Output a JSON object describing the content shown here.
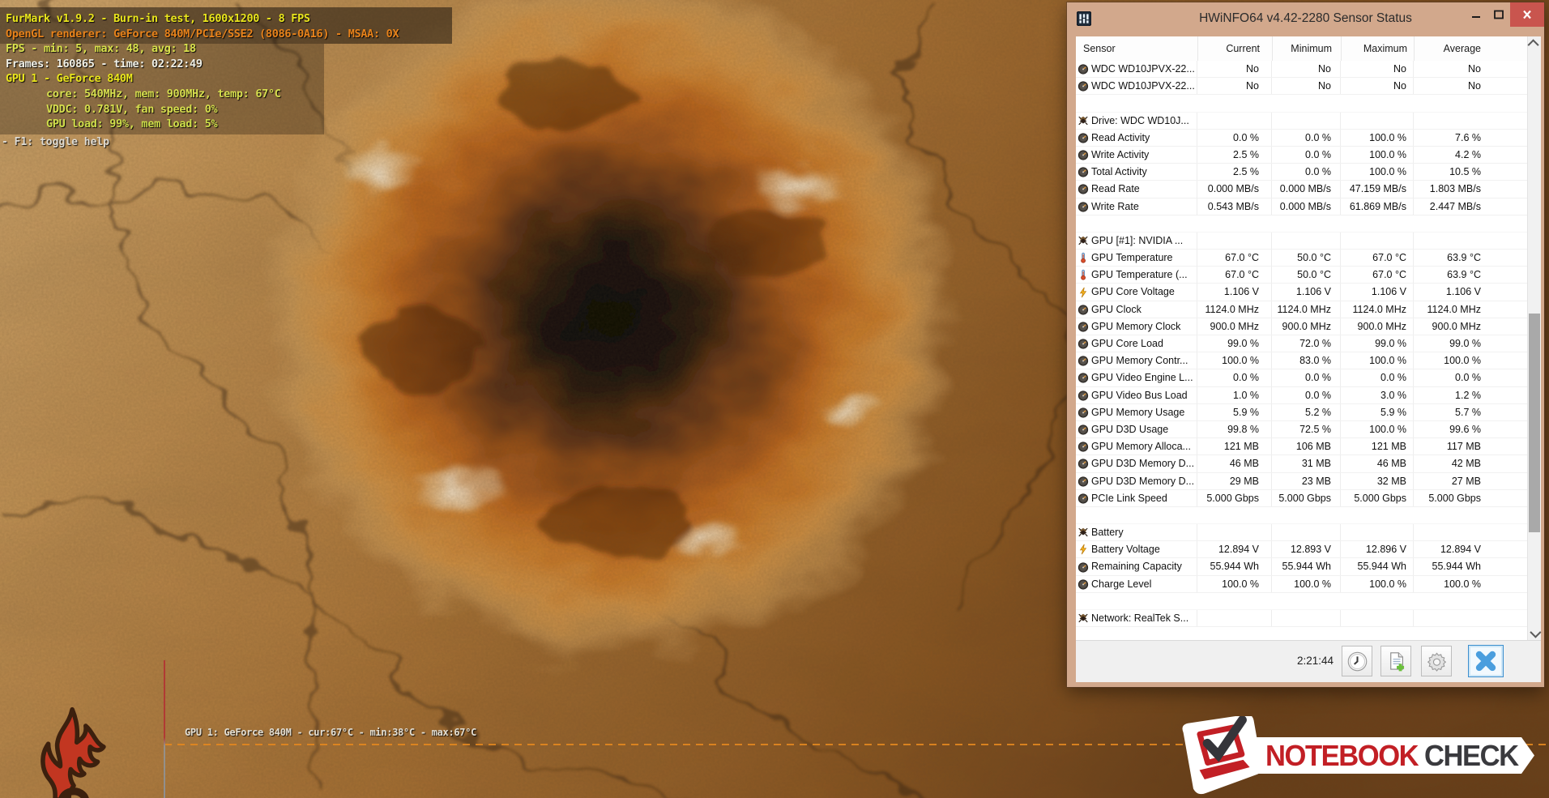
{
  "furmark_osd": {
    "lines": [
      {
        "text": "FurMark v1.9.2 - Burn-in test, 1600x1200 - 8 FPS",
        "color": "#e9e51c",
        "indent": false
      },
      {
        "text": "OpenGL renderer: GeForce 840M/PCIe/SSE2 (8086-0A16) - MSAA: 0X",
        "color": "#e8821a",
        "indent": false
      },
      {
        "text": "FPS - min: 5, max: 48, avg: 18",
        "color": "#d9e24c",
        "indent": false
      },
      {
        "text": "Frames: 160865 - time: 02:22:49",
        "color": "#efefe6",
        "indent": false
      },
      {
        "text": "GPU 1 - GeForce 840M",
        "color": "#e9e51c",
        "indent": false
      },
      {
        "text": "core: 540MHz, mem: 900MHz, temp: 67°C",
        "color": "#d6de4e",
        "indent": true
      },
      {
        "text": "VDDC: 0.781V, fan speed: 0%",
        "color": "#d6de4e",
        "indent": true
      },
      {
        "text": "GPU load: 99%, mem load: 5%",
        "color": "#cede4a",
        "indent": true
      }
    ],
    "help_text": "- F1: toggle help",
    "temp_graph_label": "GPU 1: GeForce 840M - cur:67°C - min:38°C - max:67°C"
  },
  "hwinfo": {
    "title": "HWiNFO64 v4.42-2280 Sensor Status",
    "columns": [
      "Sensor",
      "Current",
      "Minimum",
      "Maximum",
      "Average"
    ],
    "rows": [
      {
        "type": "sensor",
        "icon": "gauge-icon",
        "label": "WDC WD10JPVX-22...",
        "values": [
          "No",
          "No",
          "No",
          "No"
        ]
      },
      {
        "type": "sensor",
        "icon": "gauge-icon",
        "label": "WDC WD10JPVX-22...",
        "values": [
          "No",
          "No",
          "No",
          "No"
        ]
      },
      {
        "type": "blank"
      },
      {
        "type": "section",
        "icon": "chip-icon",
        "label": "Drive: WDC WD10J..."
      },
      {
        "type": "sensor",
        "icon": "gauge-icon",
        "label": "Read Activity",
        "values": [
          "0.0 %",
          "0.0 %",
          "100.0 %",
          "7.6 %"
        ]
      },
      {
        "type": "sensor",
        "icon": "gauge-icon",
        "label": "Write Activity",
        "values": [
          "2.5 %",
          "0.0 %",
          "100.0 %",
          "4.2 %"
        ]
      },
      {
        "type": "sensor",
        "icon": "gauge-icon",
        "label": "Total Activity",
        "values": [
          "2.5 %",
          "0.0 %",
          "100.0 %",
          "10.5 %"
        ]
      },
      {
        "type": "sensor",
        "icon": "gauge-icon",
        "label": "Read Rate",
        "values": [
          "0.000 MB/s",
          "0.000 MB/s",
          "47.159 MB/s",
          "1.803 MB/s"
        ]
      },
      {
        "type": "sensor",
        "icon": "gauge-icon",
        "label": "Write Rate",
        "values": [
          "0.543 MB/s",
          "0.000 MB/s",
          "61.869 MB/s",
          "2.447 MB/s"
        ]
      },
      {
        "type": "blank"
      },
      {
        "type": "section",
        "icon": "chip-icon",
        "label": "GPU [#1]: NVIDIA ..."
      },
      {
        "type": "sensor",
        "icon": "temp-icon",
        "label": "GPU Temperature",
        "values": [
          "67.0 °C",
          "50.0 °C",
          "67.0 °C",
          "63.9 °C"
        ]
      },
      {
        "type": "sensor",
        "icon": "temp-icon",
        "label": "GPU Temperature (...",
        "values": [
          "67.0 °C",
          "50.0 °C",
          "67.0 °C",
          "63.9 °C"
        ]
      },
      {
        "type": "sensor",
        "icon": "volt-icon",
        "label": "GPU Core Voltage",
        "values": [
          "1.106 V",
          "1.106 V",
          "1.106 V",
          "1.106 V"
        ]
      },
      {
        "type": "sensor",
        "icon": "gauge-icon",
        "label": "GPU Clock",
        "values": [
          "1124.0 MHz",
          "1124.0 MHz",
          "1124.0 MHz",
          "1124.0 MHz"
        ]
      },
      {
        "type": "sensor",
        "icon": "gauge-icon",
        "label": "GPU Memory Clock",
        "values": [
          "900.0 MHz",
          "900.0 MHz",
          "900.0 MHz",
          "900.0 MHz"
        ]
      },
      {
        "type": "sensor",
        "icon": "gauge-icon",
        "label": "GPU Core Load",
        "values": [
          "99.0 %",
          "72.0 %",
          "99.0 %",
          "99.0 %"
        ]
      },
      {
        "type": "sensor",
        "icon": "gauge-icon",
        "label": "GPU Memory Contr...",
        "values": [
          "100.0 %",
          "83.0 %",
          "100.0 %",
          "100.0 %"
        ]
      },
      {
        "type": "sensor",
        "icon": "gauge-icon",
        "label": "GPU Video Engine L...",
        "values": [
          "0.0 %",
          "0.0 %",
          "0.0 %",
          "0.0 %"
        ]
      },
      {
        "type": "sensor",
        "icon": "gauge-icon",
        "label": "GPU Video Bus Load",
        "values": [
          "1.0 %",
          "0.0 %",
          "3.0 %",
          "1.2 %"
        ]
      },
      {
        "type": "sensor",
        "icon": "gauge-icon",
        "label": "GPU Memory Usage",
        "values": [
          "5.9 %",
          "5.2 %",
          "5.9 %",
          "5.7 %"
        ]
      },
      {
        "type": "sensor",
        "icon": "gauge-icon",
        "label": "GPU D3D Usage",
        "values": [
          "99.8 %",
          "72.5 %",
          "100.0 %",
          "99.6 %"
        ]
      },
      {
        "type": "sensor",
        "icon": "gauge-icon",
        "label": "GPU Memory Alloca...",
        "values": [
          "121 MB",
          "106 MB",
          "121 MB",
          "117 MB"
        ]
      },
      {
        "type": "sensor",
        "icon": "gauge-icon",
        "label": "GPU D3D Memory D...",
        "values": [
          "46 MB",
          "31 MB",
          "46 MB",
          "42 MB"
        ]
      },
      {
        "type": "sensor",
        "icon": "gauge-icon",
        "label": "GPU D3D Memory D...",
        "values": [
          "29 MB",
          "23 MB",
          "32 MB",
          "27 MB"
        ]
      },
      {
        "type": "sensor",
        "icon": "gauge-icon",
        "label": "PCIe Link Speed",
        "values": [
          "5.000 Gbps",
          "5.000 Gbps",
          "5.000 Gbps",
          "5.000 Gbps"
        ]
      },
      {
        "type": "blank"
      },
      {
        "type": "section",
        "icon": "chip-icon",
        "label": "Battery"
      },
      {
        "type": "sensor",
        "icon": "volt-icon",
        "label": "Battery Voltage",
        "values": [
          "12.894 V",
          "12.893 V",
          "12.896 V",
          "12.894 V"
        ]
      },
      {
        "type": "sensor",
        "icon": "gauge-icon",
        "label": "Remaining Capacity",
        "values": [
          "55.944 Wh",
          "55.944 Wh",
          "55.944 Wh",
          "55.944 Wh"
        ]
      },
      {
        "type": "sensor",
        "icon": "gauge-icon",
        "label": "Charge Level",
        "values": [
          "100.0 %",
          "100.0 %",
          "100.0 %",
          "100.0 %"
        ]
      },
      {
        "type": "blank"
      },
      {
        "type": "section",
        "icon": "chip-icon",
        "label": "Network: RealTek S..."
      }
    ],
    "statusbar": {
      "time": "2:21:44",
      "buttons": [
        {
          "name": "clock-button",
          "icon": "clock-icon"
        },
        {
          "name": "report-button",
          "icon": "report-add-icon"
        },
        {
          "name": "settings-button",
          "icon": "gear-icon"
        },
        {
          "name": "close-sensors-button",
          "icon": "close-x-icon"
        }
      ]
    }
  },
  "watermark": {
    "text_primary": "NOTEBOOK",
    "text_secondary": "CHECK"
  },
  "colors": {
    "titlebar_tan": "#d2a88c",
    "close_red": "#c9554e",
    "accent_blue": "#4a9ede",
    "osd_yellow": "#e9e51c",
    "osd_orange": "#e8821a",
    "graph_line_orange": "#e2871f",
    "logo_red": "#c21f25"
  }
}
